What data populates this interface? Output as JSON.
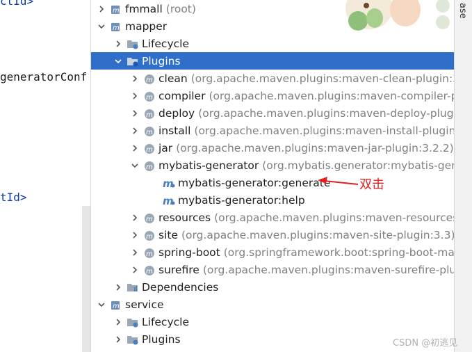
{
  "editor": {
    "lines": [
      {
        "prefix": "",
        "tag": "ctId>"
      },
      {
        "prefix": "generatorConf",
        "tag": ""
      },
      {
        "prefix": "",
        "tag": "tId>"
      }
    ]
  },
  "tree": {
    "fmmall": {
      "label": "fmmall",
      "suffix": "(root)"
    },
    "mapper": {
      "label": "mapper"
    },
    "mapper_lifecycle": {
      "label": "Lifecycle"
    },
    "mapper_plugins": {
      "label": "Plugins"
    },
    "plugins": [
      {
        "name": "clean",
        "detail": "(org.apache.maven.plugins:maven-clean-plugin:3.1.0"
      },
      {
        "name": "compiler",
        "detail": "(org.apache.maven.plugins:maven-compiler-plug"
      },
      {
        "name": "deploy",
        "detail": "(org.apache.maven.plugins:maven-deploy-plugin:2"
      },
      {
        "name": "install",
        "detail": "(org.apache.maven.plugins:maven-install-plugin:2.5."
      },
      {
        "name": "jar",
        "detail": "(org.apache.maven.plugins:maven-jar-plugin:3.2.2)"
      },
      {
        "name": "mybatis-generator",
        "detail": "(org.mybatis.generator:mybatis-genera"
      }
    ],
    "goals": [
      {
        "name": "mybatis-generator:generate"
      },
      {
        "name": "mybatis-generator:help"
      }
    ],
    "plugins2": [
      {
        "name": "resources",
        "detail": "(org.apache.maven.plugins:maven-resources-plu"
      },
      {
        "name": "site",
        "detail": "(org.apache.maven.plugins:maven-site-plugin:3.3)"
      },
      {
        "name": "spring-boot",
        "detail": "(org.springframework.boot:spring-boot-mave"
      },
      {
        "name": "surefire",
        "detail": "(org.apache.maven.plugins:maven-surefire-plugin:"
      }
    ],
    "mapper_dependencies": {
      "label": "Dependencies"
    },
    "service": {
      "label": "service"
    },
    "service_lifecycle": {
      "label": "Lifecycle"
    },
    "service_plugins": {
      "label": "Plugins"
    }
  },
  "annotation": {
    "text": "双击"
  },
  "right_bar": {
    "label": "ase"
  },
  "watermark": {
    "text": "CSDN @初逃见"
  },
  "colors": {
    "selection": "#2f6fc9",
    "annotation": "#e02020",
    "maven_icon": "#4a7fbf"
  }
}
